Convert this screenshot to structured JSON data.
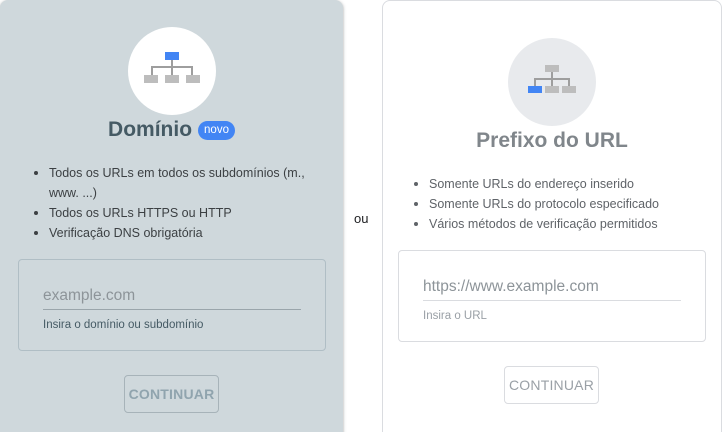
{
  "domain_card": {
    "icon": "domain-sitemap-icon",
    "title": "Domínio",
    "badge": "novo",
    "bullets": [
      "Todos os URLs em todos os subdomínios (m., www. ...)",
      "Todos os URLs HTTPS ou HTTP",
      "Verificação DNS obrigatória"
    ],
    "input_placeholder": "example.com",
    "input_value": "",
    "helper": "Insira o domínio ou subdomínio",
    "button": "CONTINUAR"
  },
  "separator": "ou",
  "prefix_card": {
    "icon": "url-prefix-sitemap-icon",
    "title": "Prefixo do URL",
    "bullets": [
      "Somente URLs do endereço inserido",
      "Somente URLs do protocolo especificado",
      "Vários métodos de verificação permitidos"
    ],
    "input_placeholder": "https://www.example.com",
    "input_value": "",
    "helper": "Insira o URL",
    "button": "CONTINUAR"
  },
  "colors": {
    "accent": "#4285f4",
    "selected_card": "#cfd8dc",
    "node_grey": "#bdbdbd"
  }
}
